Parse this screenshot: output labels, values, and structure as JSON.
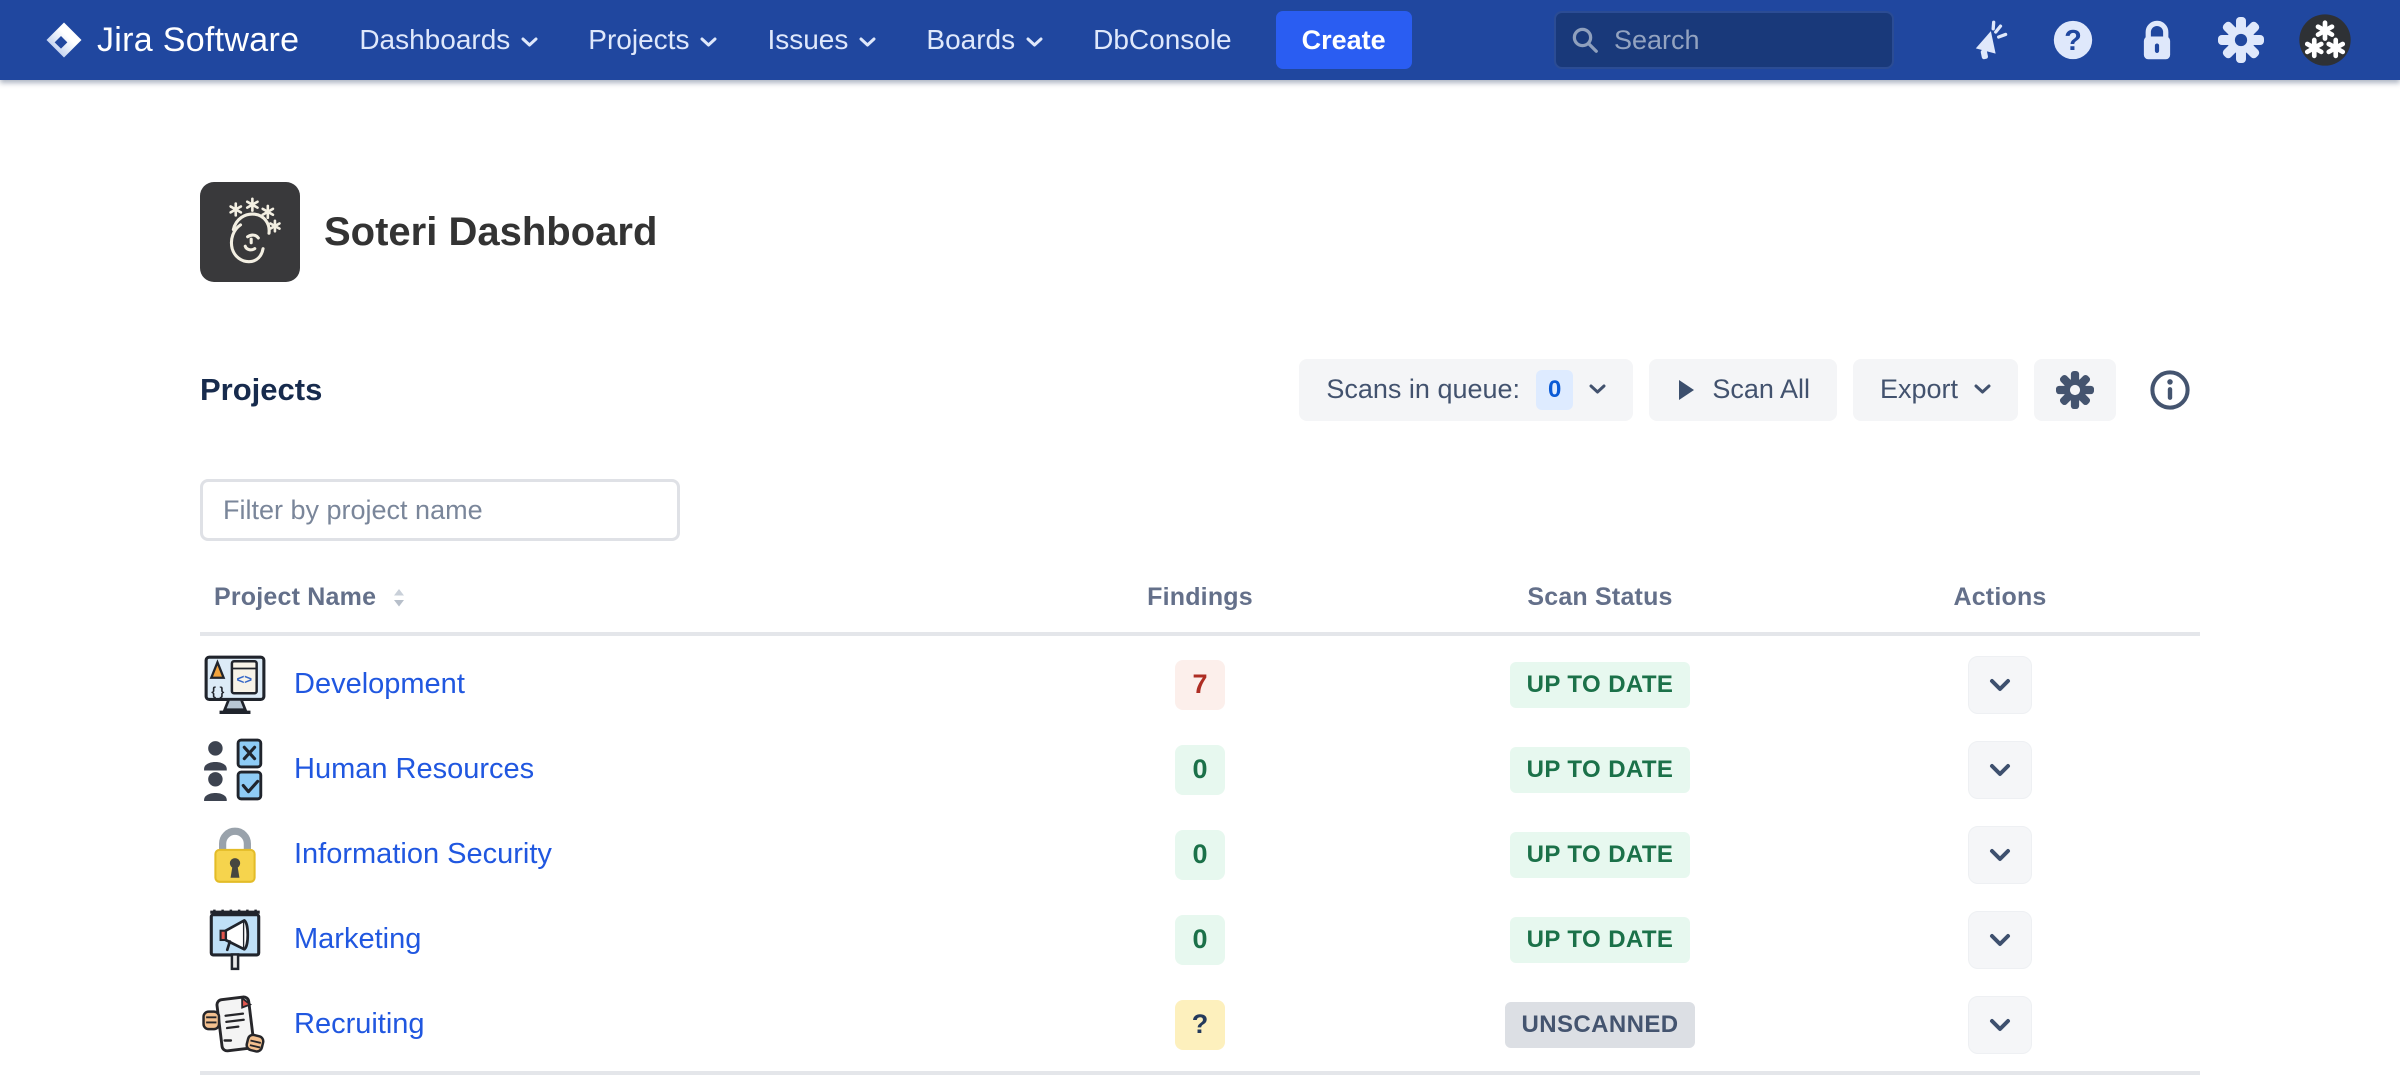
{
  "navbar": {
    "logo_text": "Jira Software",
    "items": [
      {
        "label": "Dashboards",
        "dropdown": true
      },
      {
        "label": "Projects",
        "dropdown": true
      },
      {
        "label": "Issues",
        "dropdown": true
      },
      {
        "label": "Boards",
        "dropdown": true
      },
      {
        "label": "DbConsole",
        "dropdown": false
      }
    ],
    "create_label": "Create",
    "search_placeholder": "Search",
    "right_icons": [
      "megaphone-icon",
      "help-icon",
      "lock-icon",
      "gear-icon",
      "user-avatar"
    ]
  },
  "header": {
    "title": "Soteri Dashboard",
    "app_icon": "soteri-face-stars-icon"
  },
  "toolbar": {
    "section_title": "Projects",
    "scans_in_queue_label": "Scans in queue:",
    "scans_in_queue_count": "0",
    "scan_all_label": "Scan All",
    "export_label": "Export",
    "icons": [
      "play-icon",
      "chevron-down-icon",
      "gear-icon",
      "info-icon"
    ]
  },
  "filter": {
    "placeholder": "Filter by project name"
  },
  "table": {
    "columns": [
      "Project Name",
      "Findings",
      "Scan Status",
      "Actions"
    ],
    "rows": [
      {
        "name": "Development",
        "icon": "development-project-icon",
        "findings": "7",
        "findings_variant": "red",
        "status": "UP TO DATE",
        "status_variant": "green"
      },
      {
        "name": "Human Resources",
        "icon": "hr-project-icon",
        "findings": "0",
        "findings_variant": "green",
        "status": "UP TO DATE",
        "status_variant": "green"
      },
      {
        "name": "Information Security",
        "icon": "lock-project-icon",
        "findings": "0",
        "findings_variant": "green",
        "status": "UP TO DATE",
        "status_variant": "green"
      },
      {
        "name": "Marketing",
        "icon": "marketing-project-icon",
        "findings": "0",
        "findings_variant": "green",
        "status": "UP TO DATE",
        "status_variant": "green"
      },
      {
        "name": "Recruiting",
        "icon": "recruiting-project-icon",
        "findings": "?",
        "findings_variant": "yellow",
        "status": "UNSCANNED",
        "status_variant": "gray"
      }
    ]
  },
  "colors": {
    "navbar_bg": "#20479f",
    "create_button": "#2a5df2",
    "link_blue": "#2057e0",
    "findings_red_bg": "#fcefeb",
    "findings_red_text": "#ae2e24",
    "success_bg": "#e7f8ef",
    "success_text": "#1b7149",
    "warning_bg": "#fdf0bd",
    "neutral_badge_bg": "#dcdfe4",
    "neutral_badge_text": "#44546f",
    "queue_badge_bg": "#deebff",
    "queue_badge_text": "#0a5ad6"
  }
}
